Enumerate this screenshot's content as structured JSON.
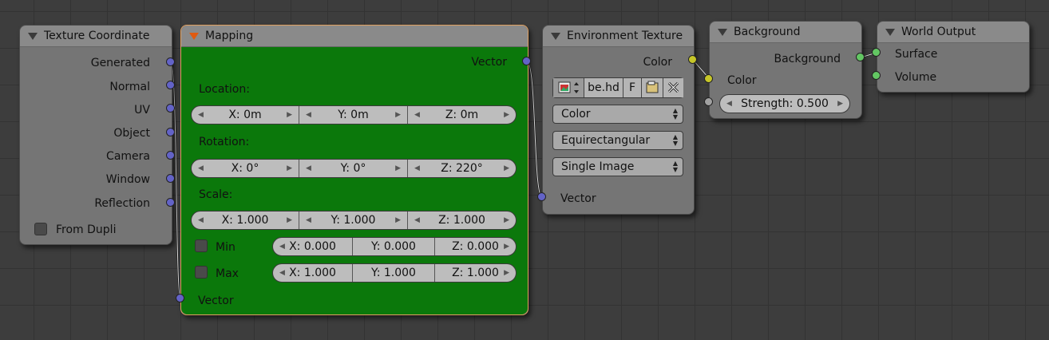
{
  "texture_coordinate": {
    "title": "Texture Coordinate",
    "outputs": [
      "Generated",
      "Normal",
      "UV",
      "Object",
      "Camera",
      "Window",
      "Reflection"
    ],
    "from_dupli": "From Dupli"
  },
  "mapping": {
    "title": "Mapping",
    "output": "Vector",
    "location_label": "Location:",
    "location": [
      "X: 0m",
      "Y: 0m",
      "Z: 0m"
    ],
    "rotation_label": "Rotation:",
    "rotation": [
      "X: 0°",
      "Y: 0°",
      "Z: 220°"
    ],
    "scale_label": "Scale:",
    "scale": [
      "X: 1.000",
      "Y: 1.000",
      "Z: 1.000"
    ],
    "min_label": "Min",
    "min": [
      "X: 0.000",
      "Y: 0.000",
      "Z: 0.000"
    ],
    "max_label": "Max",
    "max": [
      "X: 1.000",
      "Y: 1.000",
      "Z: 1.000"
    ],
    "input": "Vector",
    "accent": "#0b780b"
  },
  "environment_texture": {
    "title": "Environment Texture",
    "output": "Color",
    "image_name": "be.hd",
    "fake_user": "F",
    "color_space": "Color",
    "projection": "Equirectangular",
    "source": "Single Image",
    "input": "Vector"
  },
  "background": {
    "title": "Background",
    "output": "Background",
    "color_input": "Color",
    "strength": "Strength: 0.500"
  },
  "world_output": {
    "title": "World Output",
    "surface": "Surface",
    "volume": "Volume"
  },
  "colors": {
    "vector_socket": "#6363c7",
    "color_socket": "#c7c729",
    "shader_socket": "#63c763",
    "value_socket": "#a1a1a1",
    "selected_border": "#e0a060"
  }
}
